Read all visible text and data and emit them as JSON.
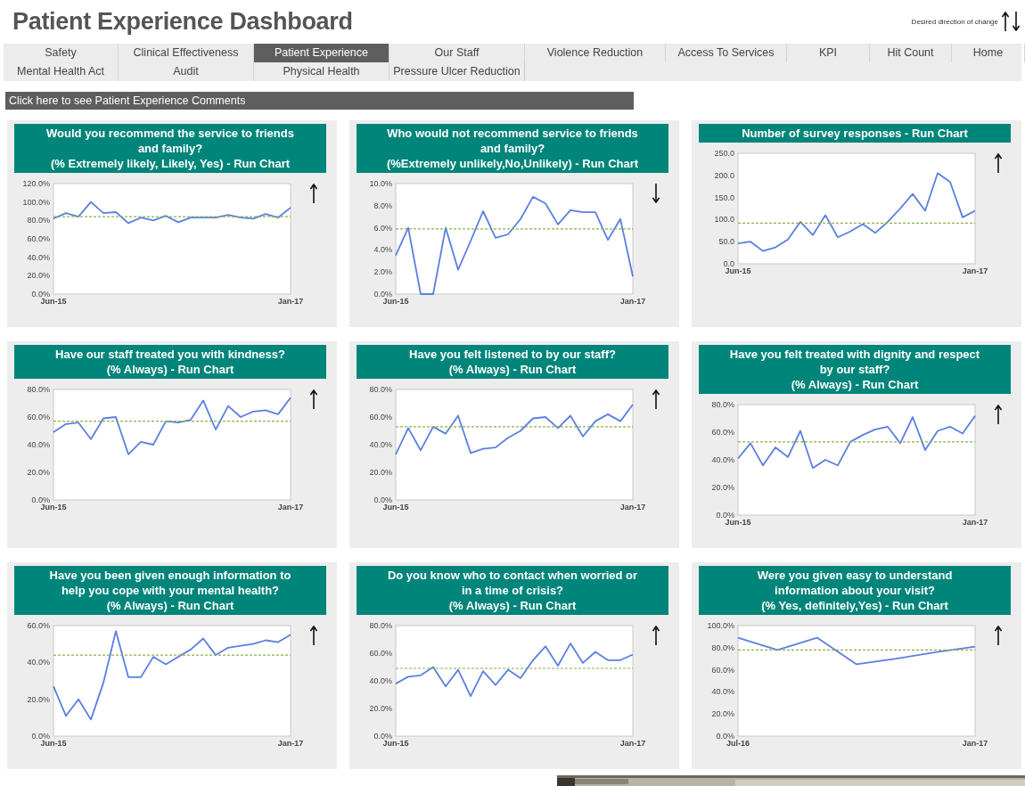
{
  "title": "Patient Experience Dashboard",
  "legend": {
    "label": "Desired direction of change"
  },
  "nav": [
    {
      "label": "Safety",
      "selected": false
    },
    {
      "label": "Clinical Effectiveness",
      "selected": false
    },
    {
      "label": "Patient Experience",
      "selected": true
    },
    {
      "label": "Our Staff",
      "selected": false
    },
    {
      "label": "Violence Reduction",
      "selected": false
    },
    {
      "label": "Access To Services",
      "selected": false
    },
    {
      "label": "KPI",
      "selected": false
    },
    {
      "label": "Hit Count",
      "selected": false
    },
    {
      "label": "Home",
      "selected": false
    },
    {
      "label": "Mental Health Act",
      "selected": false
    },
    {
      "label": "Audit",
      "selected": false
    },
    {
      "label": "Physical Health",
      "selected": false
    },
    {
      "label": "Pressure Ulcer Reduction",
      "selected": false
    }
  ],
  "comments_button": "Click here to see Patient Experience Comments",
  "panels": [
    {
      "title": "Would you recommend the service to friends\nand family?\n(% Extremely likely, Likely, Yes) - Run Chart",
      "kind": "up",
      "chart_data": {
        "type": "line",
        "categories": [
          "Jun-15",
          null,
          null,
          null,
          null,
          null,
          null,
          null,
          null,
          null,
          null,
          null,
          null,
          null,
          null,
          null,
          null,
          null,
          null,
          "Jan-17"
        ],
        "ylim": [
          0,
          120
        ],
        "yticks": [
          {
            "value": 0,
            "label": "0.0%"
          },
          {
            "value": 20,
            "label": "20.0%"
          },
          {
            "value": 40,
            "label": "40.0%"
          },
          {
            "value": 60,
            "label": "60.0%"
          },
          {
            "value": 80,
            "label": "80.0%"
          },
          {
            "value": 100,
            "label": "100.0%"
          },
          {
            "value": 120,
            "label": "120.0%"
          }
        ],
        "series": [
          {
            "color": "#5b7fe0",
            "values": [
              82,
              88,
              84,
              100,
              88,
              89,
              77,
              83,
              80,
              85,
              78,
              83,
              83,
              83,
              86,
              83,
              82,
              87,
              83,
              94
            ]
          },
          {
            "color": "#8db04a",
            "line_style": "dashed",
            "values": [
              84,
              84,
              84,
              84,
              84,
              84,
              84,
              84,
              84,
              84,
              84,
              84,
              84,
              84,
              84,
              84,
              84,
              84,
              84,
              84
            ]
          }
        ]
      }
    },
    {
      "title": "Who would not recommend service to friends\nand family?\n(%Extremely unlikely,No,Unlikely)  - Run Chart",
      "kind": "down",
      "chart_data": {
        "type": "line",
        "categories": [
          "Jun-15",
          null,
          null,
          null,
          null,
          null,
          null,
          null,
          null,
          null,
          null,
          null,
          null,
          null,
          null,
          null,
          null,
          null,
          null,
          "Jan-17"
        ],
        "ylim": [
          0,
          10
        ],
        "yticks": [
          {
            "value": 0,
            "label": "0.0%"
          },
          {
            "value": 2,
            "label": "2.0%"
          },
          {
            "value": 4,
            "label": "4.0%"
          },
          {
            "value": 6,
            "label": "6.0%"
          },
          {
            "value": 8,
            "label": "8.0%"
          },
          {
            "value": 10,
            "label": "10.0%"
          }
        ],
        "series": [
          {
            "color": "#5b7fe0",
            "values": [
              3.5,
              6,
              0,
              0,
              6,
              2.2,
              4.8,
              7.5,
              5.1,
              5.4,
              6.8,
              8.8,
              8.2,
              6.3,
              7.6,
              7.4,
              7.4,
              4.9,
              6.8,
              1.6
            ]
          },
          {
            "color": "#8db04a",
            "line_style": "dashed",
            "values": [
              5.9,
              5.9,
              5.9,
              5.9,
              5.9,
              5.9,
              5.9,
              5.9,
              5.9,
              5.9,
              5.9,
              5.9,
              5.9,
              5.9,
              5.9,
              5.9,
              5.9,
              5.9,
              5.9,
              5.9
            ]
          }
        ]
      }
    },
    {
      "title": "Number of survey responses - Run Chart",
      "kind": "up",
      "chart_data": {
        "type": "line",
        "categories": [
          "Jun-15",
          null,
          null,
          null,
          null,
          null,
          null,
          null,
          null,
          null,
          null,
          null,
          null,
          null,
          null,
          null,
          null,
          null,
          null,
          "Jan-17"
        ],
        "ylim": [
          0,
          250
        ],
        "yticks": [
          {
            "value": 0,
            "label": "0.0"
          },
          {
            "value": 50,
            "label": "50.0"
          },
          {
            "value": 100,
            "label": "100.0"
          },
          {
            "value": 150,
            "label": "150.0"
          },
          {
            "value": 200,
            "label": "200.0"
          },
          {
            "value": 250,
            "label": "250.0"
          }
        ],
        "series": [
          {
            "color": "#5b7fe0",
            "values": [
              46,
              50,
              29,
              37,
              55,
              95,
              65,
              110,
              60,
              73,
              90,
              70,
              95,
              125,
              158,
              120,
              205,
              185,
              105,
              120
            ]
          },
          {
            "color": "#8db04a",
            "line_style": "dashed",
            "values": [
              92,
              92,
              92,
              92,
              92,
              92,
              92,
              92,
              92,
              92,
              92,
              92,
              92,
              92,
              92,
              92,
              92,
              92,
              92,
              92
            ]
          }
        ]
      }
    },
    {
      "title": "Have our staff treated you with kindness?\n(% Always) - Run Chart",
      "kind": "up",
      "chart_data": {
        "type": "line",
        "categories": [
          "Jun-15",
          null,
          null,
          null,
          null,
          null,
          null,
          null,
          null,
          null,
          null,
          null,
          null,
          null,
          null,
          null,
          null,
          null,
          null,
          "Jan-17"
        ],
        "ylim": [
          0,
          80
        ],
        "yticks": [
          {
            "value": 0,
            "label": "0.0%"
          },
          {
            "value": 20,
            "label": "20.0%"
          },
          {
            "value": 40,
            "label": "40.0%"
          },
          {
            "value": 60,
            "label": "60.0%"
          },
          {
            "value": 80,
            "label": "80.0%"
          }
        ],
        "series": [
          {
            "color": "#5b7fe0",
            "values": [
              49,
              55,
              56,
              44,
              59,
              60,
              33,
              42,
              40,
              57,
              56,
              58,
              72,
              51,
              68,
              60,
              64,
              65,
              62,
              74
            ]
          },
          {
            "color": "#8db04a",
            "line_style": "dashed",
            "values": [
              57,
              57,
              57,
              57,
              57,
              57,
              57,
              57,
              57,
              57,
              57,
              57,
              57,
              57,
              57,
              57,
              57,
              57,
              57,
              57
            ]
          }
        ]
      }
    },
    {
      "title": "Have you felt listened to by our staff?\n(% Always) - Run Chart",
      "kind": "up",
      "chart_data": {
        "type": "line",
        "categories": [
          "Jun-15",
          null,
          null,
          null,
          null,
          null,
          null,
          null,
          null,
          null,
          null,
          null,
          null,
          null,
          null,
          null,
          null,
          null,
          null,
          "Jan-17"
        ],
        "ylim": [
          0,
          80
        ],
        "yticks": [
          {
            "value": 0,
            "label": "0.0%"
          },
          {
            "value": 20,
            "label": "20.0%"
          },
          {
            "value": 40,
            "label": "40.0%"
          },
          {
            "value": 60,
            "label": "60.0%"
          },
          {
            "value": 80,
            "label": "80.0%"
          }
        ],
        "series": [
          {
            "color": "#5b7fe0",
            "values": [
              33,
              52,
              36,
              53,
              48,
              61,
              34,
              37,
              38,
              45,
              50,
              59,
              60,
              52,
              61,
              46,
              57,
              62,
              57,
              69
            ]
          },
          {
            "color": "#8db04a",
            "line_style": "dashed",
            "values": [
              53,
              53,
              53,
              53,
              53,
              53,
              53,
              53,
              53,
              53,
              53,
              53,
              53,
              53,
              53,
              53,
              53,
              53,
              53,
              53
            ]
          }
        ]
      }
    },
    {
      "title": "Have you felt treated with dignity and respect\nby our staff?\n(% Always) - Run Chart",
      "kind": "up",
      "chart_data": {
        "type": "line",
        "categories": [
          "Jun-15",
          null,
          null,
          null,
          null,
          null,
          null,
          null,
          null,
          null,
          null,
          null,
          null,
          null,
          null,
          null,
          null,
          null,
          null,
          "Jan-17"
        ],
        "ylim": [
          0,
          80
        ],
        "yticks": [
          {
            "value": 0,
            "label": "0.0%"
          },
          {
            "value": 20,
            "label": "20.0%"
          },
          {
            "value": 40,
            "label": "40.0%"
          },
          {
            "value": 60,
            "label": "60.0%"
          },
          {
            "value": 80,
            "label": "80.0%"
          }
        ],
        "series": [
          {
            "color": "#5b7fe0",
            "values": [
              41,
              52,
              36,
              49,
              42,
              61,
              34,
              40,
              36,
              53,
              58,
              62,
              64,
              52,
              71,
              47,
              61,
              64,
              59,
              72
            ]
          },
          {
            "color": "#8db04a",
            "line_style": "dashed",
            "values": [
              53,
              53,
              53,
              53,
              53,
              53,
              53,
              53,
              53,
              53,
              53,
              53,
              53,
              53,
              53,
              53,
              53,
              53,
              53,
              53
            ]
          }
        ]
      }
    },
    {
      "title": "Have you been given enough information to\nhelp you cope with your mental health?\n(% Always) - Run Chart",
      "kind": "up",
      "chart_data": {
        "type": "line",
        "categories": [
          "Jun-15",
          null,
          null,
          null,
          null,
          null,
          null,
          null,
          null,
          null,
          null,
          null,
          null,
          null,
          null,
          null,
          null,
          null,
          null,
          "Jan-17"
        ],
        "ylim": [
          0,
          60
        ],
        "yticks": [
          {
            "value": 0,
            "label": "0.0%"
          },
          {
            "value": 20,
            "label": "20.0%"
          },
          {
            "value": 40,
            "label": "40.0%"
          },
          {
            "value": 60,
            "label": "60.0%"
          }
        ],
        "series": [
          {
            "color": "#5b7fe0",
            "values": [
              27,
              11,
              20,
              9,
              29,
              57,
              32,
              32,
              43,
              39,
              43,
              47,
              53,
              44,
              48,
              49,
              50,
              52,
              51,
              55
            ]
          },
          {
            "color": "#8db04a",
            "line_style": "dashed",
            "values": [
              44,
              44,
              44,
              44,
              44,
              44,
              44,
              44,
              44,
              44,
              44,
              44,
              44,
              44,
              44,
              44,
              44,
              44,
              44,
              44
            ]
          }
        ]
      }
    },
    {
      "title": "Do you know who to contact when worried or\nin a time of crisis?\n(% Always) - Run Chart",
      "kind": "up",
      "chart_data": {
        "type": "line",
        "categories": [
          "Jun-15",
          null,
          null,
          null,
          null,
          null,
          null,
          null,
          null,
          null,
          null,
          null,
          null,
          null,
          null,
          null,
          null,
          null,
          null,
          "Jan-17"
        ],
        "ylim": [
          0,
          80
        ],
        "yticks": [
          {
            "value": 0,
            "label": "0.0%"
          },
          {
            "value": 20,
            "label": "20.0%"
          },
          {
            "value": 40,
            "label": "40.0%"
          },
          {
            "value": 60,
            "label": "60.0%"
          },
          {
            "value": 80,
            "label": "80.0%"
          }
        ],
        "series": [
          {
            "color": "#5b7fe0",
            "values": [
              38,
              43,
              44,
              50,
              36,
              48,
              29,
              47,
              37,
              48,
              42,
              55,
              65,
              51,
              67,
              53,
              61,
              55,
              55,
              59
            ]
          },
          {
            "color": "#8db04a",
            "line_style": "dashed",
            "values": [
              49,
              49,
              49,
              49,
              49,
              49,
              49,
              49,
              49,
              49,
              49,
              49,
              49,
              49,
              49,
              49,
              49,
              49,
              49,
              49
            ]
          }
        ]
      }
    },
    {
      "title": "Were you given easy to understand\ninformation about your visit?\n(% Yes, definitely,Yes) - Run Chart",
      "kind": "up",
      "chart_data": {
        "type": "line",
        "categories": [
          "Jul-16",
          null,
          null,
          null,
          null,
          null,
          "Jan-17"
        ],
        "ylim": [
          0,
          100
        ],
        "yticks": [
          {
            "value": 0,
            "label": "0.0%"
          },
          {
            "value": 20,
            "label": "20.0%"
          },
          {
            "value": 40,
            "label": "40.0%"
          },
          {
            "value": 60,
            "label": "60.0%"
          },
          {
            "value": 80,
            "label": "80.0%"
          },
          {
            "value": 100,
            "label": "100.0%"
          }
        ],
        "series": [
          {
            "color": "#5b7fe0",
            "values": [
              89,
              78,
              89,
              65,
              70,
              76,
              81
            ]
          },
          {
            "color": "#8db04a",
            "line_style": "dashed",
            "values": [
              78,
              78,
              78,
              78,
              78,
              78,
              78
            ]
          }
        ]
      }
    }
  ]
}
